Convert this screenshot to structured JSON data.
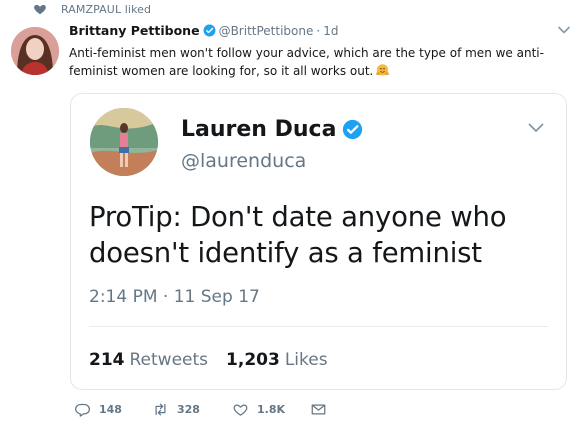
{
  "activity": {
    "liked_by": "RAMZPAUL liked"
  },
  "tweet": {
    "author_name": "Brittany Pettibone",
    "author_handle": "@BrittPettibone",
    "separator": "·",
    "age": "1d",
    "text": "Anti-feminist men won't follow your advice, which are the type of men we anti-feminist women are looking for, so it all works out."
  },
  "quote": {
    "author_name": "Lauren Duca",
    "author_handle": "@laurenduca",
    "text": "ProTip: Don't date anyone who doesn't identify as a feminist",
    "timestamp": "2:14 PM · 11 Sep 17",
    "retweets_count": "214",
    "retweets_label": "Retweets",
    "likes_count": "1,203",
    "likes_label": "Likes"
  },
  "actions": {
    "reply_count": "148",
    "retweet_count": "328",
    "like_count": "1.8K"
  },
  "colors": {
    "verified": "#1da1f2",
    "muted": "#657786",
    "border": "#e1e8ed",
    "hug_emoji": "#f4b942"
  },
  "icons": [
    "heart-icon",
    "verified-icon",
    "chevron-down-icon",
    "hug-emoji-icon",
    "reply-icon",
    "retweet-icon",
    "like-icon",
    "direct-message-icon"
  ]
}
